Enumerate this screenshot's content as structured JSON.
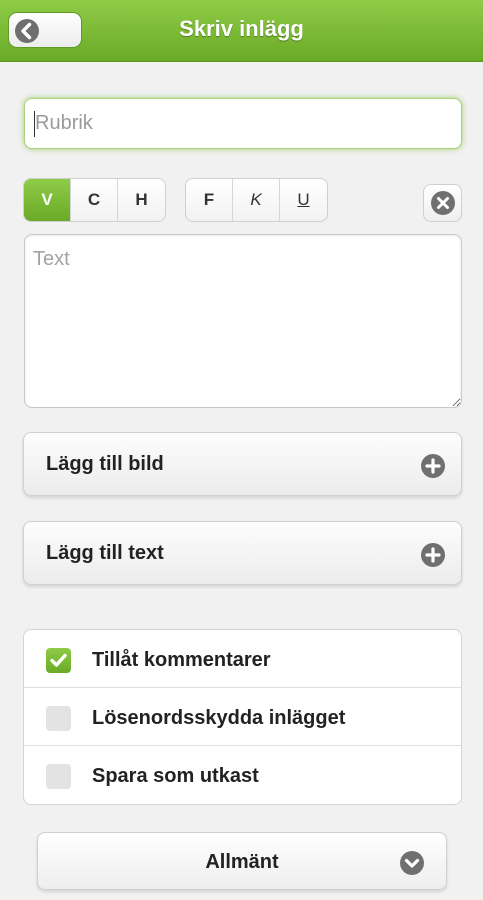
{
  "header": {
    "title": "Skriv inlägg",
    "back_icon": "chevron-left-icon"
  },
  "title_field": {
    "placeholder": "Rubrik",
    "value": ""
  },
  "alignment": {
    "buttons": [
      {
        "label": "V",
        "active": true
      },
      {
        "label": "C",
        "active": false
      },
      {
        "label": "H",
        "active": false
      }
    ]
  },
  "formatting": {
    "buttons": [
      {
        "label": "F",
        "style": "bold"
      },
      {
        "label": "K",
        "style": "italic"
      },
      {
        "label": "U",
        "style": "underline"
      }
    ]
  },
  "clear_icon": "close-circle-icon",
  "text_field": {
    "placeholder": "Text",
    "value": ""
  },
  "actions": {
    "add_image_label": "Lägg till bild",
    "add_text_label": "Lägg till text",
    "icon": "plus-circle-icon"
  },
  "options": [
    {
      "label": "Tillåt kommentarer",
      "checked": true
    },
    {
      "label": "Lösenordsskydda inlägget",
      "checked": false
    },
    {
      "label": "Spara som utkast",
      "checked": false
    }
  ],
  "category": {
    "selected": "Allmänt",
    "icon": "chevron-down-icon"
  },
  "colors": {
    "accent": "#79b833",
    "icon_gray": "#6f6f6f"
  }
}
